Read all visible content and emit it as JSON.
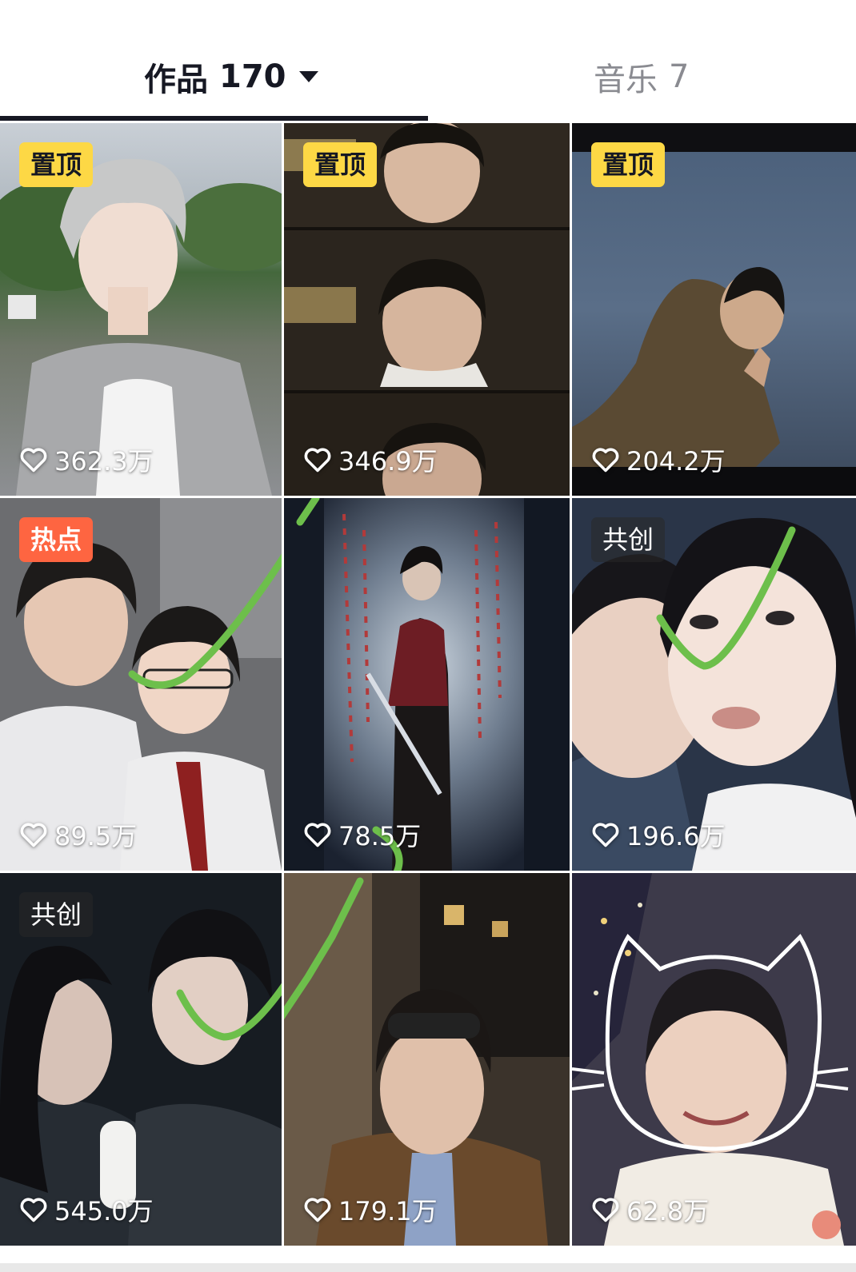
{
  "tabs": {
    "works": {
      "label": "作品",
      "count": "170"
    },
    "music": {
      "label": "音乐",
      "count": "7"
    }
  },
  "videos": [
    {
      "badge": "置顶",
      "badge_type": "pinned",
      "likes": "362.3万",
      "thumb": "gray-haired young man in gray hoodie, cloudy park"
    },
    {
      "badge": "置顶",
      "badge_type": "pinned",
      "likes": "346.9万",
      "thumb": "repeated close-up frames of dark-haired young man"
    },
    {
      "badge": "置顶",
      "badge_type": "pinned",
      "likes": "204.2万",
      "thumb": "man in coat making peace sign by the sea at dusk"
    },
    {
      "badge": "热点",
      "badge_type": "hot",
      "likes": "89.5万",
      "thumb": "couple in school uniforms posing",
      "checkmark": true
    },
    {
      "badge": "",
      "badge_type": "none",
      "likes": "78.5万",
      "thumb": "man in red jacket holding a sword in a dark hallway"
    },
    {
      "badge": "共创",
      "badge_type": "cocreate",
      "likes": "196.6万",
      "thumb": "close-up selfie of a couple",
      "checkmark": true
    },
    {
      "badge": "共创",
      "badge_type": "cocreate",
      "likes": "545.0万",
      "thumb": "couple in dark moody lighting",
      "checkmark": true
    },
    {
      "badge": "",
      "badge_type": "none",
      "likes": "179.1万",
      "thumb": "man with sunglasses on head on a night street"
    },
    {
      "badge": "",
      "badge_type": "none",
      "likes": "62.8万",
      "thumb": "smiling young man with cat face drawing overlay"
    }
  ],
  "colors": {
    "pinned_badge": "#fdd845",
    "hot_badge": "#fe6541",
    "checkmark": "#6dbf4b",
    "tab_active": "#161823",
    "tab_inactive": "#8a8b91"
  },
  "icons": {
    "like": "heart-outline-icon",
    "dropdown": "caret-down-icon"
  }
}
